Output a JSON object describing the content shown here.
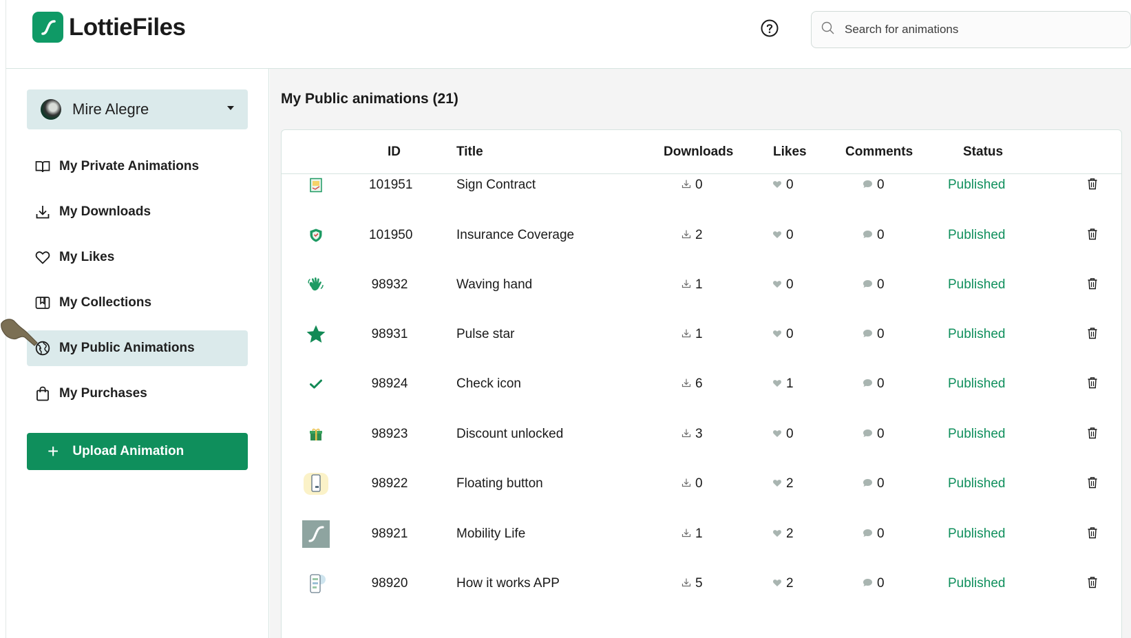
{
  "brand": {
    "name": "LottieFiles",
    "accent": "#0f9a66"
  },
  "header": {
    "help_icon": "question-circle-icon",
    "search_placeholder": "Search for animations"
  },
  "sidebar": {
    "user_name": "Mire Alegre",
    "items": [
      {
        "label": "My Private Animations",
        "icon": "book-icon",
        "active": false
      },
      {
        "label": "My Downloads",
        "icon": "download-icon",
        "active": false
      },
      {
        "label": "My Likes",
        "icon": "heart-icon",
        "active": false
      },
      {
        "label": "My Collections",
        "icon": "collection-icon",
        "active": false
      },
      {
        "label": "My Public Animations",
        "icon": "globe-icon",
        "active": true
      },
      {
        "label": "My Purchases",
        "icon": "bag-icon",
        "active": false
      }
    ],
    "upload_label": "Upload Animation"
  },
  "main": {
    "title": "My Public animations (21)",
    "columns": {
      "id": "ID",
      "title": "Title",
      "downloads": "Downloads",
      "likes": "Likes",
      "comments": "Comments",
      "status": "Status"
    },
    "rows": [
      {
        "thumb": "contract-thumb",
        "id": "101951",
        "title": "Sign Contract",
        "downloads": "0",
        "likes": "0",
        "comments": "0",
        "status": "Published"
      },
      {
        "thumb": "shield-thumb",
        "id": "101950",
        "title": "Insurance Coverage",
        "downloads": "2",
        "likes": "0",
        "comments": "0",
        "status": "Published"
      },
      {
        "thumb": "hand-thumb",
        "id": "98932",
        "title": "Waving hand",
        "downloads": "1",
        "likes": "0",
        "comments": "0",
        "status": "Published"
      },
      {
        "thumb": "star-thumb",
        "id": "98931",
        "title": "Pulse star",
        "downloads": "1",
        "likes": "0",
        "comments": "0",
        "status": "Published"
      },
      {
        "thumb": "check-thumb",
        "id": "98924",
        "title": "Check icon",
        "downloads": "6",
        "likes": "1",
        "comments": "0",
        "status": "Published"
      },
      {
        "thumb": "gift-thumb",
        "id": "98923",
        "title": "Discount unlocked",
        "downloads": "3",
        "likes": "0",
        "comments": "0",
        "status": "Published"
      },
      {
        "thumb": "phone-thumb",
        "id": "98922",
        "title": "Floating button",
        "downloads": "0",
        "likes": "2",
        "comments": "0",
        "status": "Published"
      },
      {
        "thumb": "lottie-thumb",
        "id": "98921",
        "title": "Mobility Life",
        "downloads": "1",
        "likes": "2",
        "comments": "0",
        "status": "Published"
      },
      {
        "thumb": "app-thumb",
        "id": "98920",
        "title": "How it works APP",
        "downloads": "5",
        "likes": "2",
        "comments": "0",
        "status": "Published"
      }
    ]
  }
}
